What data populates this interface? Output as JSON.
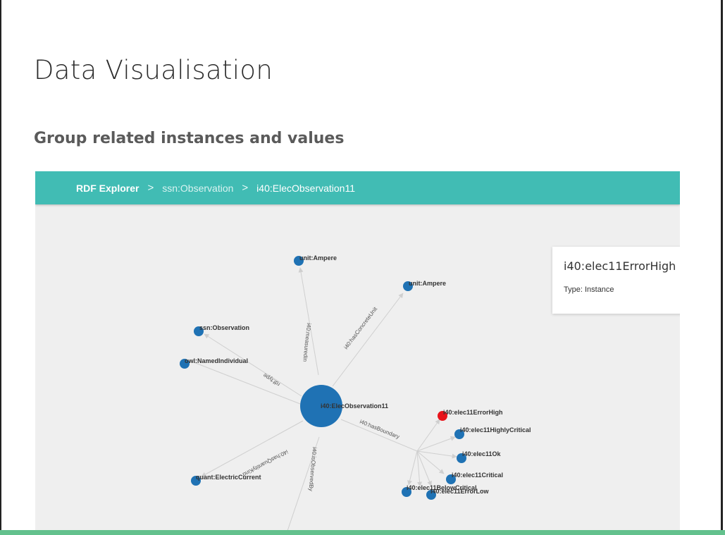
{
  "slide": {
    "title": "Data Visualisation",
    "subtitle": "Group related instances and values"
  },
  "breadcrumb": {
    "root": "RDF Explorer",
    "separator": ">",
    "middle": "ssn:Observation",
    "current": "i40:ElecObservation11"
  },
  "info_card": {
    "title": "i40:elec11ErrorHigh",
    "type": "Type: Instance"
  },
  "colors": {
    "topbar": "#41bcb4",
    "node": "#1f72b4",
    "selected_node": "#e8141b",
    "edge": "#cfcfcf",
    "bottom_bar": "#63c18d"
  },
  "graph": {
    "central_node": "i40:ElecObservation11",
    "nodes": [
      "unit:Ampere",
      "unit:Ampere",
      "ssn:Observation",
      "owl:NamedIndividual",
      "quant:ElectricCurrent",
      "i40:elec11ErrorHigh",
      "i40:elec11HighlyCritical",
      "i40:elec11Ok",
      "i40:elec11Critical",
      "i40:elec11BelowCritical",
      "i40:elec11ErrorLow"
    ],
    "edges": [
      "i40:measuredIn",
      "i40:hasConcreteUnit",
      "rdf:type",
      "i40:hasQuantityKind",
      "i40:isObservedBy",
      "i40:hasBoundary"
    ]
  }
}
